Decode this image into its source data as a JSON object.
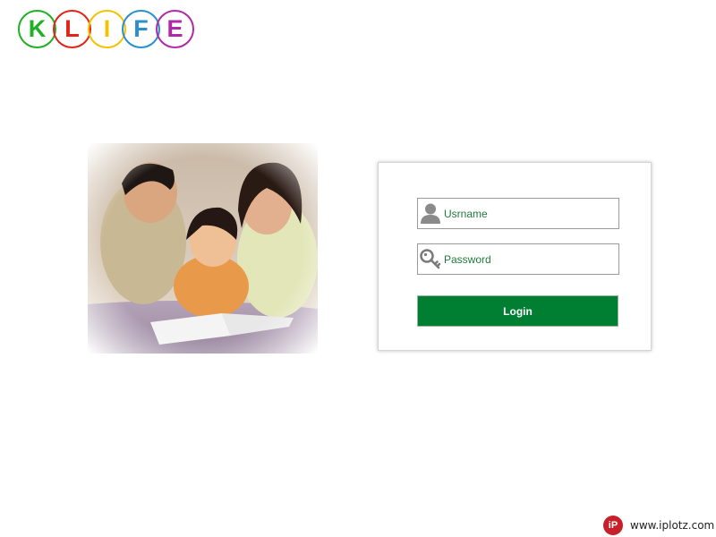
{
  "logo": {
    "letters": [
      {
        "char": "K",
        "color": "#1fb024"
      },
      {
        "char": "L",
        "color": "#e2231a"
      },
      {
        "char": "I",
        "color": "#f2c400"
      },
      {
        "char": "F",
        "color": "#2a8fd0"
      },
      {
        "char": "E",
        "color": "#b02aa8"
      }
    ]
  },
  "login": {
    "username_placeholder": "Usrname",
    "password_placeholder": "Password",
    "login_label": "Login"
  },
  "icons": {
    "username": "user-icon",
    "password": "key-icon"
  },
  "colors": {
    "accent": "#007f33",
    "field_text": "#1f7a3c"
  },
  "watermark": {
    "badge": "iP",
    "text": "www.iplotz.com"
  }
}
